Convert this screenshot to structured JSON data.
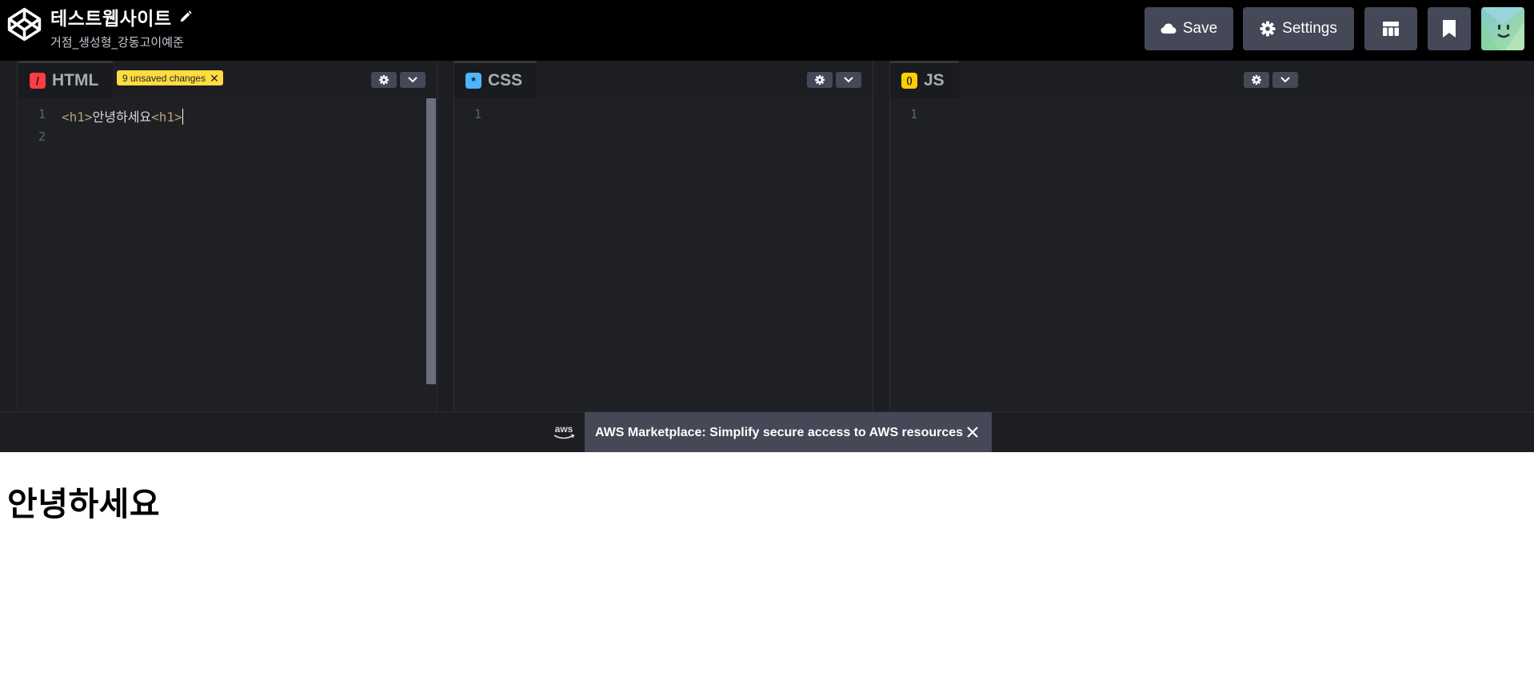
{
  "header": {
    "title": "테스트웹사이트",
    "subtitle": "거점_생성형_강동고이예준",
    "save_label": "Save",
    "settings_label": "Settings"
  },
  "editors": [
    {
      "name": "HTML",
      "icon_text": "/",
      "icon_color": "#ff3c41",
      "badge": "9 unsaved changes",
      "line_numbers": [
        "1",
        "2"
      ],
      "code": {
        "open_tag": "<h1>",
        "text": "안녕하세요",
        "close_tag": "<h1>"
      }
    },
    {
      "name": "CSS",
      "icon_text": "*",
      "icon_color": "#47cf73",
      "line_numbers": [
        "1"
      ]
    },
    {
      "name": "JS",
      "icon_text": "()",
      "icon_color": "#fcd000",
      "line_numbers": [
        "1"
      ]
    }
  ],
  "ad": {
    "text": "AWS Marketplace: Simplify secure access to AWS resources",
    "logo_text": "aws"
  },
  "preview": {
    "heading": "안녕하세요"
  },
  "icons": {
    "logo": "codepen-logo-icon",
    "pencil": "pencil-icon",
    "save": "cloud-icon",
    "settings": "gear-icon",
    "layout": "layout-icon",
    "bookmark": "bookmark-icon",
    "close": "close-icon"
  }
}
